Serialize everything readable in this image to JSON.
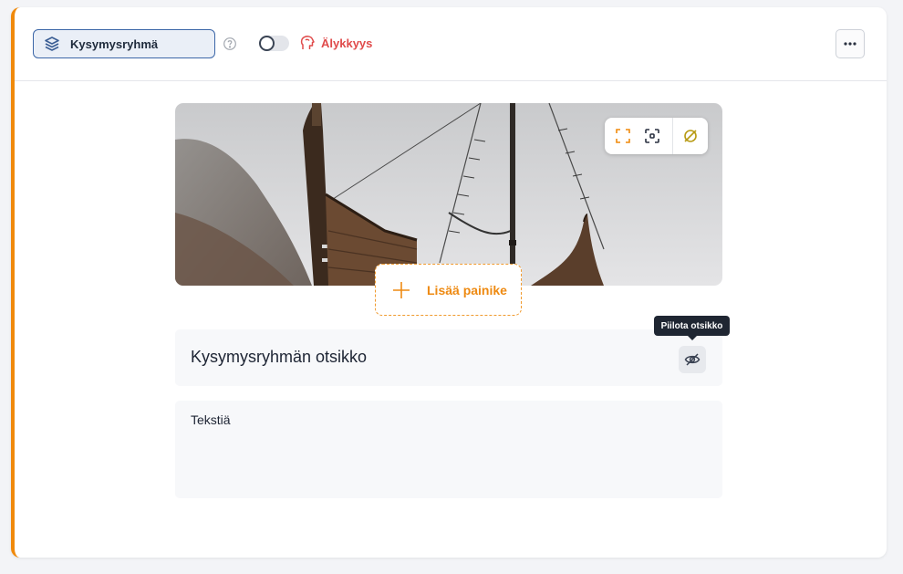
{
  "header": {
    "type_label": "Kysymysryhmä",
    "type_icon": "layers-icon",
    "help_icon": "help-circle-icon",
    "toggle_on": false,
    "smart_label": "Älykkyys",
    "smart_icon": "brain-icon",
    "more_icon": "ellipsis-icon"
  },
  "image_toolbar": {
    "icons": [
      "expand-icon",
      "focus-point-icon",
      "remove-image-icon"
    ]
  },
  "add_button": {
    "label": "Lisää painike",
    "icon": "plus-icon"
  },
  "title_field": {
    "value": "Kysymysryhmän otsikko",
    "hide_tooltip": "Piilota otsikko",
    "hide_icon": "eye-off-icon"
  },
  "text_field": {
    "value": "Tekstiä"
  },
  "colors": {
    "accent": "#f08a0c",
    "smart": "#e04b4b",
    "pill_border": "#3c67a8"
  }
}
